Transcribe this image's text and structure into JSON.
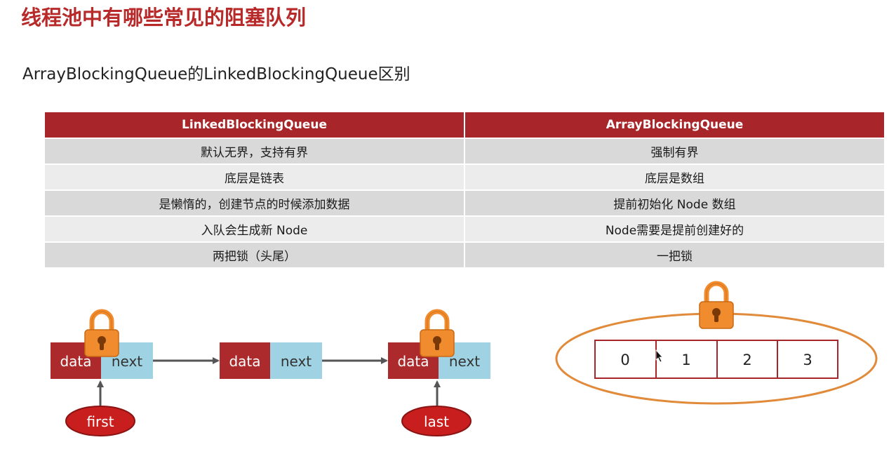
{
  "page_title": "线程池中有哪些常见的阻塞队列",
  "subtitle": "ArrayBlockingQueue的LinkedBlockingQueue区别",
  "table": {
    "headers": [
      "LinkedBlockingQueue",
      "ArrayBlockingQueue"
    ],
    "rows": [
      [
        "默认无界，支持有界",
        "强制有界"
      ],
      [
        "底层是链表",
        "底层是数组"
      ],
      [
        "是懒惰的，创建节点的时候添加数据",
        "提前初始化 Node 数组"
      ],
      [
        "入队会生成新 Node",
        "Node需要是提前创建好的"
      ],
      [
        "两把锁（头尾）",
        "一把锁"
      ]
    ]
  },
  "linked_diagram": {
    "nodes": [
      {
        "data_label": "data",
        "next_label": "next"
      },
      {
        "data_label": "data",
        "next_label": "next"
      },
      {
        "data_label": "data",
        "next_label": "next"
      }
    ],
    "pointers": [
      "first",
      "last"
    ]
  },
  "array_diagram": {
    "cells": [
      "0",
      "1",
      "2",
      "3"
    ]
  },
  "colors": {
    "title_red": "#b82a2a",
    "header_red": "#a8262a",
    "data_red": "#ac2a2c",
    "next_blue": "#9fd3e3",
    "lock_orange": "#f08c2e",
    "ellipse_orange": "#e08a3a",
    "pointer_red": "#c81e1e"
  }
}
